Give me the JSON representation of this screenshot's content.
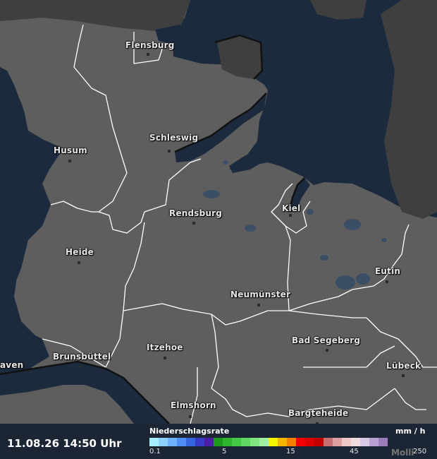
{
  "cities": [
    {
      "name": "Flensburg"
    },
    {
      "name": "Schleswig"
    },
    {
      "name": "Husum"
    },
    {
      "name": "Rendsburg"
    },
    {
      "name": "Kiel"
    },
    {
      "name": "Heide"
    },
    {
      "name": "Eutin"
    },
    {
      "name": "Neumünster"
    },
    {
      "name": "Bad Segeberg"
    },
    {
      "name": "Brunsbüttel"
    },
    {
      "name": "Itzehoe"
    },
    {
      "name": "Lübeck"
    },
    {
      "name": "Elmshorn"
    },
    {
      "name": "Bargteheide"
    },
    {
      "name": "aven"
    }
  ],
  "footer": {
    "timestamp": "11.08.26 14:50 Uhr",
    "legend_title": "Niederschlagsrate",
    "legend_unit": "mm / h",
    "ticks": [
      "0.1",
      "5",
      "15",
      "45",
      "250"
    ],
    "watermark": "Molli"
  },
  "colors": {
    "land": "#5e5e5e",
    "land_dark": "#3f3f3f",
    "water": "#1b2b3d",
    "border": "#ffffff",
    "scale": [
      "#a6eeff",
      "#8ed1ff",
      "#6fb3ff",
      "#4f8ef5",
      "#3566e0",
      "#3b3ac6",
      "#4c1ea6",
      "#1c9a1c",
      "#2db52d",
      "#45c845",
      "#62d862",
      "#80e680",
      "#9ef09e",
      "#f5f500",
      "#f5b400",
      "#f58000",
      "#f50000",
      "#dc0000",
      "#c30000",
      "#c87070",
      "#dca0a0",
      "#f0c8c8",
      "#f0dcdc",
      "#d7c8e6",
      "#b9a0d2",
      "#9b7dbe"
    ]
  }
}
